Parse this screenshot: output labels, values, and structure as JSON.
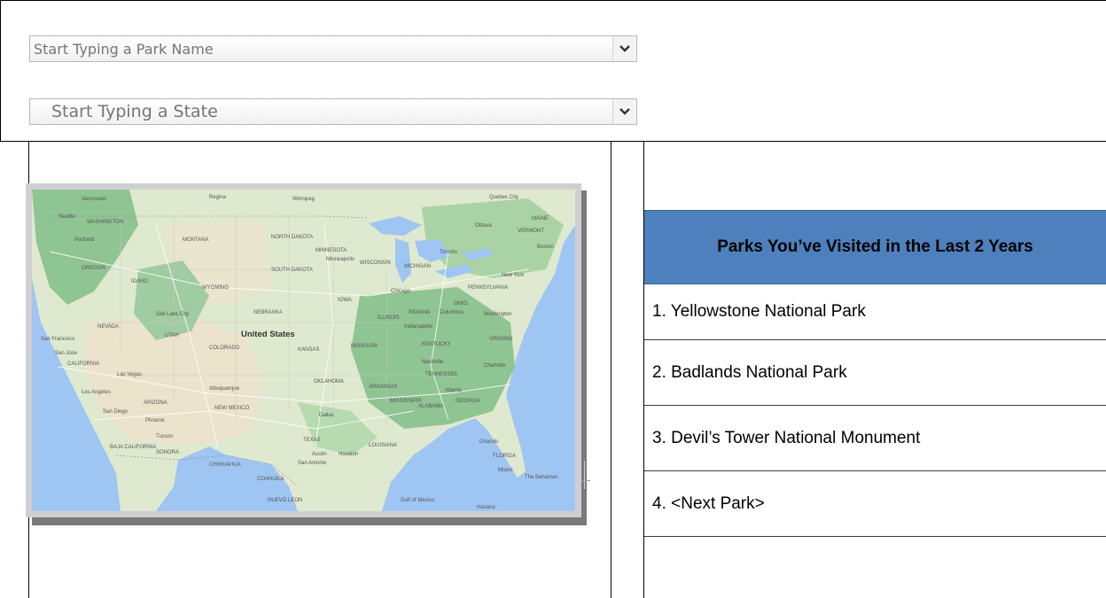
{
  "form": {
    "park_placeholder": "Start Typing a Park Name",
    "state_placeholder": "Start Typing a State"
  },
  "map": {
    "country_label": "United States",
    "labels": [
      "Vancouver",
      "Seattle",
      "Portland",
      "WASHINGTON",
      "OREGON",
      "MONTANA",
      "IDAHO",
      "WYOMING",
      "Winnipeg",
      "Regina",
      "NORTH DAKOTA",
      "SOUTH DAKOTA",
      "MINNESOTA",
      "Minneapolis",
      "WISCONSIN",
      "MICHIGAN",
      "Toronto",
      "Ottawa",
      "Quebec City",
      "MAINE",
      "VERMONT",
      "New York",
      "Boston",
      "PENNSYLVANIA",
      "Chicago",
      "IOWA",
      "NEBRASKA",
      "Salt Lake City",
      "NEVADA",
      "UTAH",
      "COLORADO",
      "KANSAS",
      "MISSOURI",
      "ILLINOIS",
      "INDIANA",
      "OHIO",
      "Columbus",
      "Indianapolis",
      "Washington",
      "KENTUCKY",
      "VIRGINIA",
      "San Francisco",
      "San Jose",
      "CALIFORNIA",
      "Las Vegas",
      "Los Angeles",
      "San Diego",
      "ARIZONA",
      "Phoenix",
      "Tucson",
      "Albuquerque",
      "NEW MEXICO",
      "OKLAHOMA",
      "ARKANSAS",
      "TENNESSEE",
      "Nashville",
      "Charlotte",
      "Atlanta",
      "MISSISSIPPI",
      "ALABAMA",
      "GEORGIA",
      "Dallas",
      "TEXAS",
      "Austin",
      "Houston",
      "San Antonio",
      "LOUISIANA",
      "Orlando",
      "FLORIDA",
      "Miami",
      "The Bahamas",
      "Havana",
      "Gulf of Mexico",
      "CHIHUAHUA",
      "COAHUILA",
      "SONORA",
      "BAJA CALIFORNIA",
      "NUEVO LEON"
    ]
  },
  "visited": {
    "title": "Parks You’ve Visited in the Last 2 Years",
    "items": [
      "1. Yellowstone National Park",
      "2. Badlands National Park",
      "3. Devil’s Tower National Monument",
      "4. <Next Park>"
    ]
  },
  "colors": {
    "header_bg": "#4e80bd",
    "land": "#dfe9cf",
    "forest": "#8fc493",
    "water": "#9fc5f2",
    "desert": "#ece3cd"
  }
}
